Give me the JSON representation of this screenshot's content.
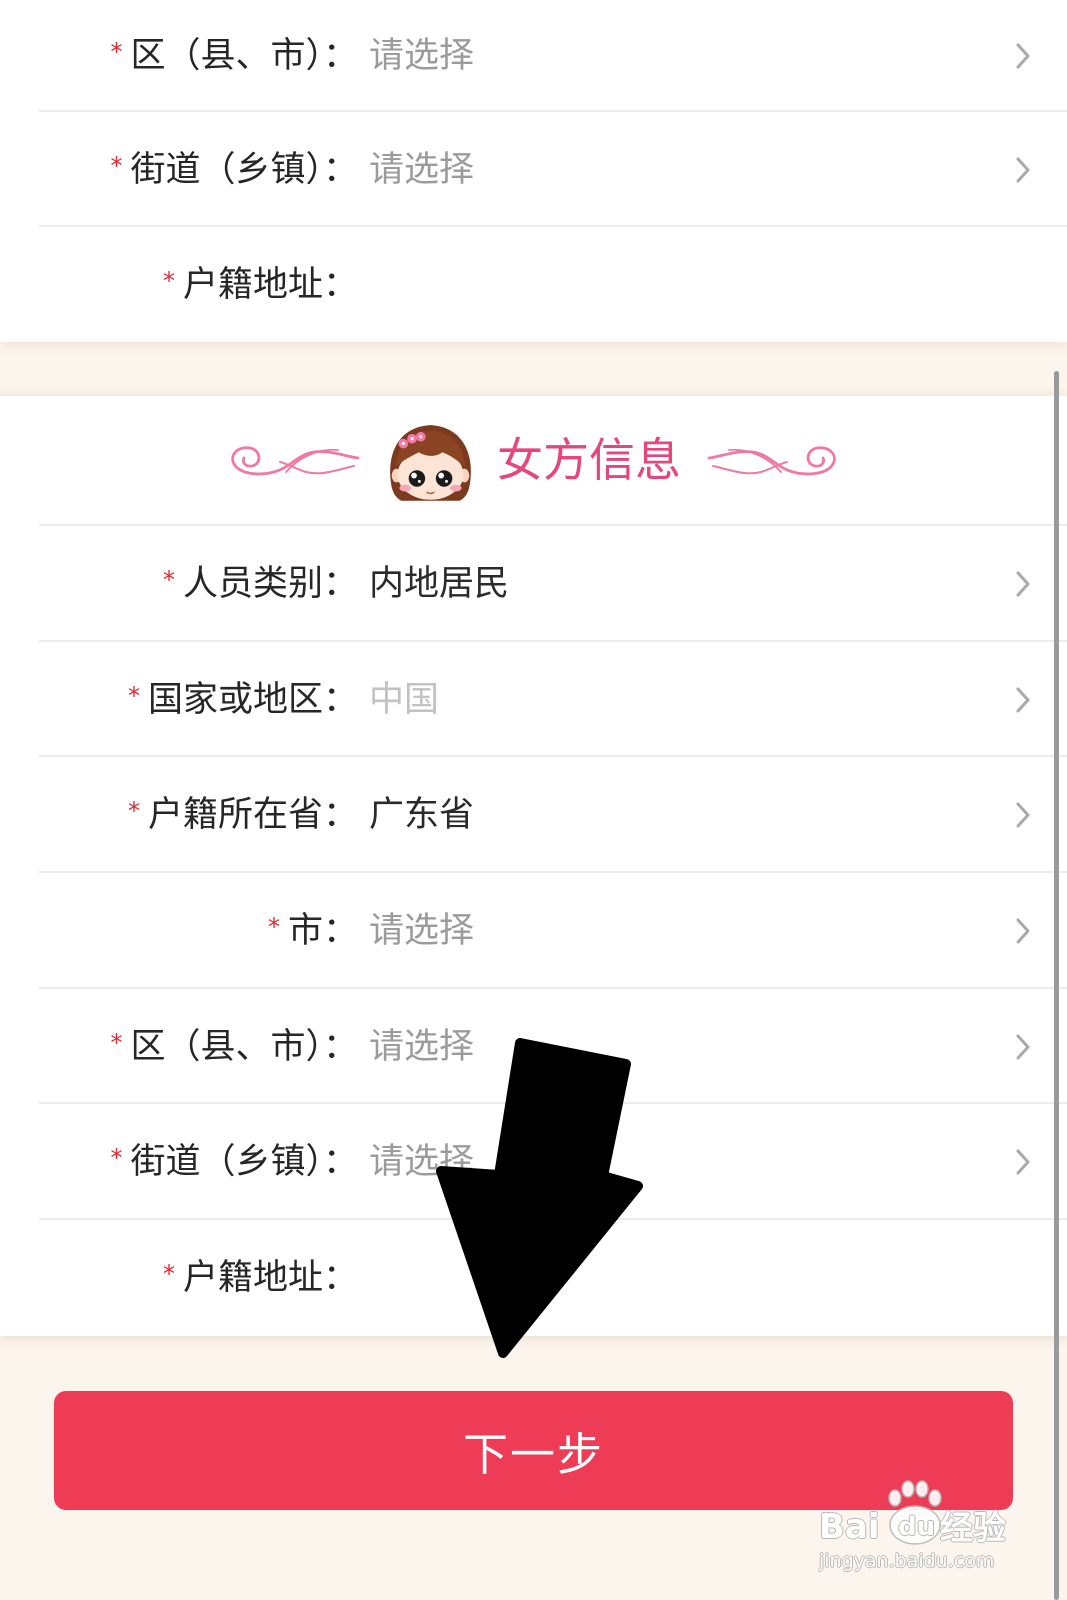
{
  "upper_form": {
    "rows": [
      {
        "required_mark": "*",
        "label": "区（县、市）：",
        "placeholder": "请选择"
      },
      {
        "required_mark": "*",
        "label": "街道（乡镇）：",
        "placeholder": "请选择"
      },
      {
        "required_mark": "*",
        "label": "户籍地址：",
        "value": ""
      }
    ]
  },
  "female_section": {
    "title": "女方信息",
    "rows": [
      {
        "required_mark": "*",
        "label": "人员类别：",
        "value": "内地居民"
      },
      {
        "required_mark": "*",
        "label": "国家或地区：",
        "value": "中国"
      },
      {
        "required_mark": "*",
        "label": "户籍所在省：",
        "value": "广东省"
      },
      {
        "required_mark": "*",
        "label": "市：",
        "placeholder": "请选择"
      },
      {
        "required_mark": "*",
        "label": "区（县、市）：",
        "placeholder": "请选择"
      },
      {
        "required_mark": "*",
        "label": "街道（乡镇）：",
        "placeholder": "请选择"
      },
      {
        "required_mark": "*",
        "label": "户籍地址：",
        "value": ""
      }
    ]
  },
  "next_button": {
    "label": "下一步"
  },
  "watermark": {
    "brand_a": "Bai",
    "brand_b": "du",
    "product": "经验",
    "url": "jingyan.baidu.com"
  },
  "icons": {
    "row_chevron": "chevron-right-icon",
    "header_left": "swirl-left-icon",
    "header_avatar": "girl-avatar-icon",
    "header_right": "swirl-right-icon",
    "annotation": "arrow-down-annotation-icon",
    "watermark_logo": "paw-logo-icon"
  },
  "colors": {
    "page_bg": "#fcf5ee",
    "card_bg": "#ffffff",
    "divider": "#ececec",
    "label": "#262626",
    "value": "#2a2a2a",
    "placeholder": "#9b9b9b",
    "disabled": "#c2c2c2",
    "required": "#e02a32",
    "chevron": "#a9a9a9",
    "title": "#e6467c",
    "ornament": "#ee7aa3",
    "button": "#ee3b56",
    "button_text": "#ffffff",
    "scrollbar": "#9a9a9a",
    "annotation": "#000000"
  }
}
